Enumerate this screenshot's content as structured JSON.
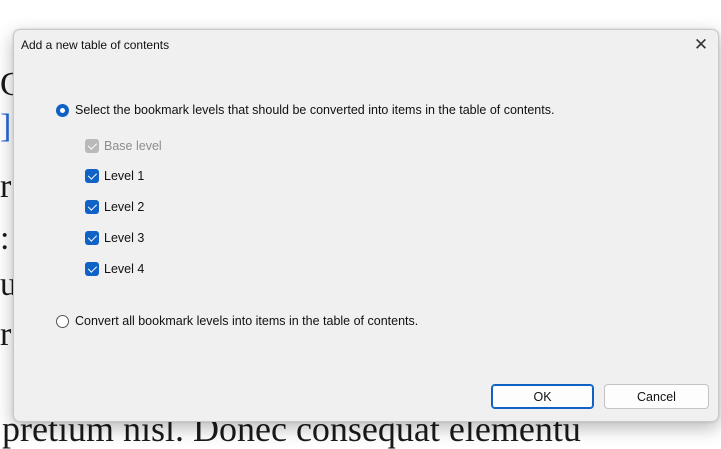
{
  "background": {
    "edge_glyphs": [
      "C",
      "]",
      "r",
      ":",
      "u",
      "r"
    ],
    "bottom_line": "pretium nisl. Donec consequat elementu"
  },
  "dialog": {
    "title": "Add a new table of contents",
    "close_glyph": "✕",
    "option_bookmark_levels": "Select the bookmark levels that should be converted into items in the table of contents.",
    "levels": [
      {
        "label": "Base level",
        "checked": true,
        "disabled": true
      },
      {
        "label": "Level 1",
        "checked": true,
        "disabled": false
      },
      {
        "label": "Level 2",
        "checked": true,
        "disabled": false
      },
      {
        "label": "Level 3",
        "checked": true,
        "disabled": false
      },
      {
        "label": "Level 4",
        "checked": true,
        "disabled": false
      }
    ],
    "option_all_levels": "Convert all bookmark levels into items in the table of contents.",
    "ok_label": "OK",
    "cancel_label": "Cancel"
  },
  "colors": {
    "accent": "#0f61c4",
    "disabled_check": "#b9b9b9",
    "dialog_bg": "#f0f0f0"
  }
}
